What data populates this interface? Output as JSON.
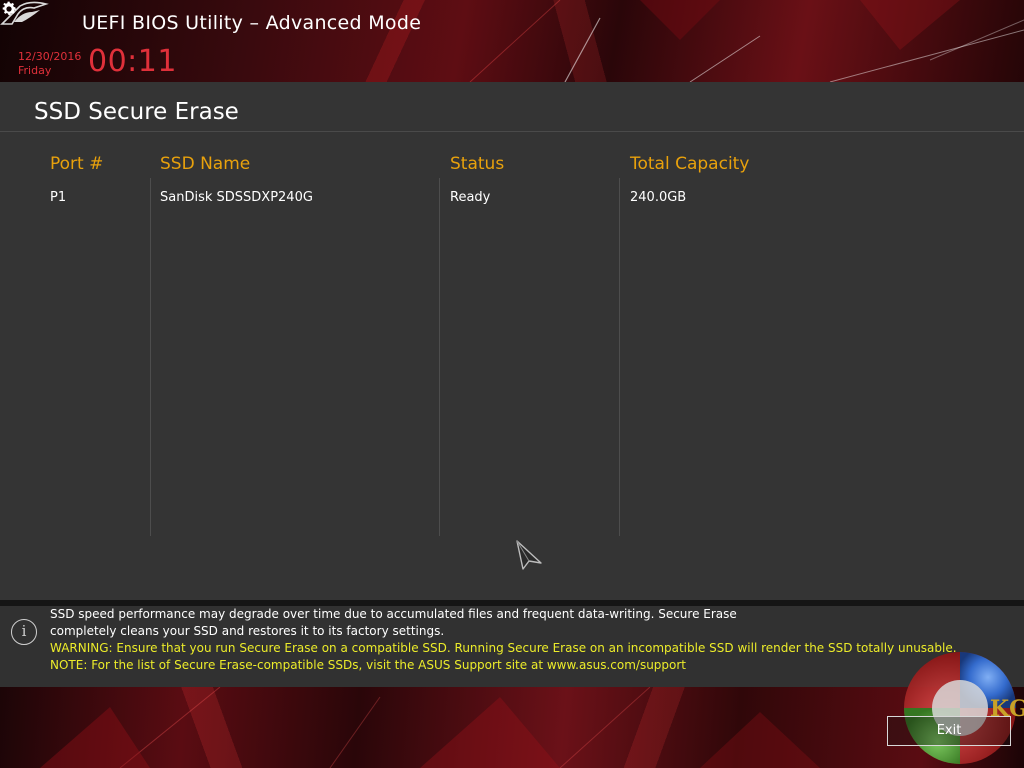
{
  "header": {
    "title": "UEFI BIOS Utility – Advanced Mode",
    "date": "12/30/2016",
    "day": "Friday",
    "time": "00:11"
  },
  "page": {
    "title": "SSD Secure Erase"
  },
  "table": {
    "columns": [
      "Port #",
      "SSD Name",
      "Status",
      "Total Capacity"
    ],
    "rows": [
      {
        "port": "P1",
        "name": "SanDisk SDSSDXP240G",
        "status": "Ready",
        "capacity": "240.0GB"
      }
    ]
  },
  "info": {
    "line1": "SSD speed performance may degrade over time due to accumulated files and frequent data-writing. Secure Erase",
    "line2": "completely cleans your SSD and restores it to its factory settings.",
    "warning": "WARNING: Ensure that you run Secure Erase on a compatible SSD. Running Secure Erase on an incompatible SSD will render the SSD totally unusable.",
    "note": "NOTE: For the list of Secure Erase-compatible SSDs, visit the ASUS Support site at www.asus.com/support"
  },
  "footer": {
    "exit_label": "Exit",
    "watermark_text": "KG"
  },
  "icons": {
    "logo": "rog-logo-icon",
    "settings": "gear-icon",
    "info": "info-icon",
    "cursor": "mouse-pointer-icon"
  },
  "colors": {
    "accent_red": "#e0303a",
    "column_header": "#e8a10c",
    "warning": "#ecec2a",
    "panel": "#343434"
  }
}
